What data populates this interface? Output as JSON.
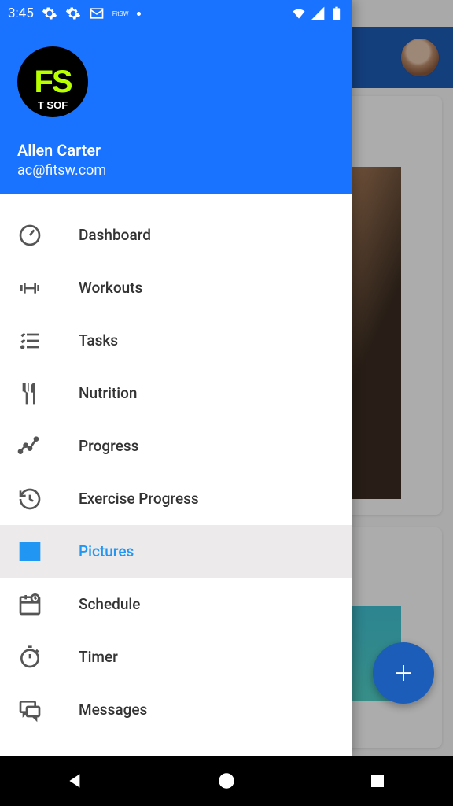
{
  "status": {
    "time": "3:45"
  },
  "profile": {
    "name": "Allen Carter",
    "email": "ac@fitsw.com"
  },
  "drawer": {
    "items": [
      {
        "label": "Dashboard",
        "icon": "gauge-icon",
        "selected": false
      },
      {
        "label": "Workouts",
        "icon": "dumbbell-icon",
        "selected": false
      },
      {
        "label": "Tasks",
        "icon": "checklist-icon",
        "selected": false
      },
      {
        "label": "Nutrition",
        "icon": "utensils-icon",
        "selected": false
      },
      {
        "label": "Progress",
        "icon": "chart-icon",
        "selected": false
      },
      {
        "label": "Exercise Progress",
        "icon": "history-icon",
        "selected": false
      },
      {
        "label": "Pictures",
        "icon": "picture-icon",
        "selected": true
      },
      {
        "label": "Schedule",
        "icon": "calendar-icon",
        "selected": false
      },
      {
        "label": "Timer",
        "icon": "stopwatch-icon",
        "selected": false
      },
      {
        "label": "Messages",
        "icon": "chat-icon",
        "selected": false
      }
    ]
  },
  "colors": {
    "primary": "#1a73ff",
    "accent": "#2196f3",
    "fab": "#1b5db8"
  }
}
